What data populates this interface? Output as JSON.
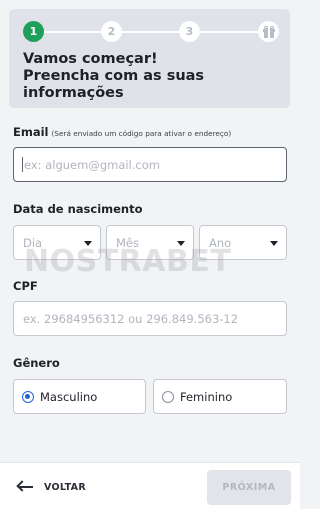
{
  "stepper": {
    "steps": [
      {
        "label": "1",
        "state": "active"
      },
      {
        "label": "2",
        "state": "pending"
      },
      {
        "label": "3",
        "state": "pending"
      },
      {
        "icon": "gift-icon",
        "state": "pending"
      }
    ]
  },
  "header": {
    "title": "Vamos começar!\nPreencha com as suas\ninformações"
  },
  "email": {
    "label": "Email",
    "hint": "(Será enviado um código para ativar o endereço)",
    "placeholder": "ex: alguem@gmail.com"
  },
  "birthdate": {
    "label": "Data de nascimento",
    "day_placeholder": "Dia",
    "month_placeholder": "Mês",
    "year_placeholder": "Ano"
  },
  "cpf": {
    "label": "CPF",
    "placeholder": "ex. 29684956312 ou 296.849.563-12"
  },
  "gender": {
    "label": "Gênero",
    "options": [
      {
        "label": "Masculino",
        "selected": true
      },
      {
        "label": "Feminino",
        "selected": false
      }
    ]
  },
  "watermark": {
    "text": "NOSTRABET"
  },
  "footer": {
    "back_label": "VOLTAR",
    "next_label": "PRÓXIMA"
  },
  "colors": {
    "accent_green": "#1ea05c",
    "radio_blue": "#1d62d6",
    "header_bg": "#dfe2e8",
    "page_bg": "#f2f3f5"
  }
}
